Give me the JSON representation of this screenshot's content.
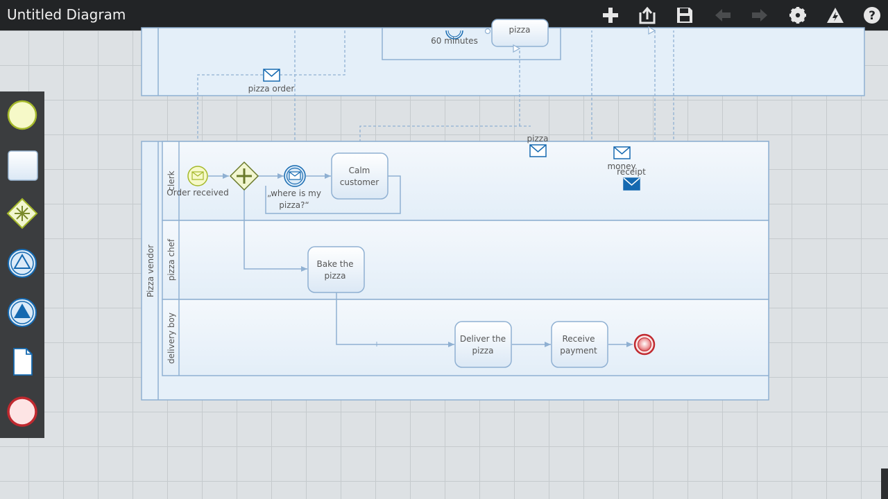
{
  "app": {
    "title": "Untitled Diagram"
  },
  "toolbar": {
    "add_icon": "plus-icon",
    "export_icon": "export-icon",
    "save_icon": "save-icon",
    "undo_icon": "undo-arrow-icon",
    "redo_icon": "redo-arrow-icon",
    "settings_icon": "gear-icon",
    "validate_icon": "warning-icon",
    "help_icon": "help-icon"
  },
  "palette": {
    "items": [
      "start-event",
      "task",
      "gateway",
      "intermediate-event",
      "throw-event",
      "data-object",
      "end-event"
    ]
  },
  "diagram": {
    "upper_pool": {
      "timer_label": "60 minutes",
      "task_partial_label": "pizza",
      "message_flow_label": "pizza order"
    },
    "pool": {
      "name": "Pizza vendor",
      "lanes": [
        "clerk",
        "pizza chef",
        "delivery boy"
      ]
    },
    "elements": {
      "start_event": "Order received",
      "intermediate_event_line1": "„where is my",
      "intermediate_event_line2": "pizza?“",
      "calm_line1": "Calm",
      "calm_line2": "customer",
      "bake_line1": "Bake the",
      "bake_line2": "pizza",
      "deliver_line1": "Deliver the",
      "deliver_line2": "pizza",
      "receive_line1": "Receive",
      "receive_line2": "payment"
    },
    "messages": {
      "pizza": "pizza",
      "money": "money",
      "receipt": "receipt"
    }
  },
  "colors": {
    "accent": "#1569b0",
    "start_event": "#a4b82a",
    "end_event": "#c0292f",
    "shape_stroke": "#8fb0d2",
    "topbar": "#222426"
  }
}
